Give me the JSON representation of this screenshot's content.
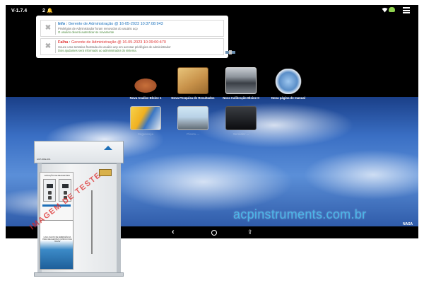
{
  "status_bar": {
    "version": "V-1.7.4",
    "notification_count": "2",
    "icons": [
      "bell-icon",
      "wifi-icon",
      "cloud-icon",
      "menu-icon"
    ]
  },
  "notifications": [
    {
      "kind": "Info",
      "manager": "Gerente de Administração",
      "timestamp": "@ 16-05-2023 10:37:08:943",
      "line1": "Privilégios de Administrador foram removidos do usuário acp",
      "line2": "O usuário deverá autenticar-se novamente",
      "color": "#1e73be"
    },
    {
      "kind": "Falha",
      "manager": "Gerente de Administração",
      "timestamp": "@ 16-05-2023 10:39:00:470",
      "line1": "Houve uma tentativa frustrada do usuário acp em acessar privilégios de administrador",
      "line2": "Dois ajudantes será informado ao administrador do sistema.",
      "color": "#e03030"
    }
  ],
  "apps": {
    "analysis": "Nova Analise Bloine 1",
    "search": "Nova Pesquisa de Resultados",
    "calibration": "Nova Calibração Bloine II",
    "manual": "Nova página de manual",
    "safety": "Segurança",
    "plant": "Planta ...",
    "server": "Servidor ..."
  },
  "watermark": "acpinstruments.com.br",
  "nasa_label": "NASA",
  "nav": {
    "back": "‹",
    "share": "⇪"
  },
  "product": {
    "tag": "ACP-DRE-001",
    "panel_title": "ESTAÇÃO DE REAGENTES",
    "poster_text": "LAVA-OLHOS DE EMERGÊNCIA PARA REAGENTES QUÍMICOS DE TESTE",
    "stamp": "IMAGEM DE TESTE"
  },
  "colors": {
    "info": "#1e73be",
    "failure": "#e03030",
    "watermark": "#4ab6e8"
  }
}
